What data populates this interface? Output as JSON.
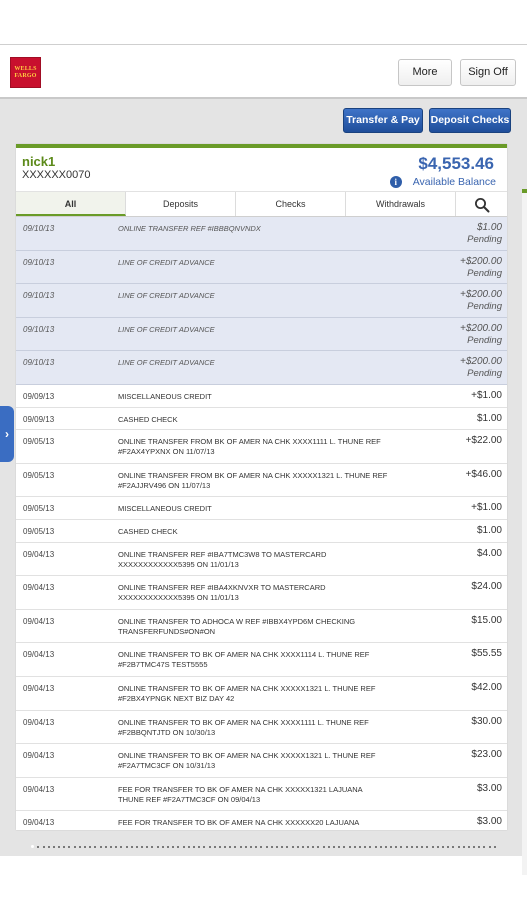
{
  "brand": {
    "logo_line1": "WELLS",
    "logo_line2": "FARGO"
  },
  "header": {
    "more_label": "More",
    "signoff_label": "Sign Off"
  },
  "actions": {
    "transfer_label": "Transfer & Pay",
    "deposit_label": "Deposit Checks"
  },
  "account": {
    "name": "nick1",
    "number": "XXXXXX0070",
    "balance": "$4,553.46",
    "balance_label": "Available Balance"
  },
  "tabs": [
    {
      "label": "All",
      "active": true
    },
    {
      "label": "Deposits",
      "active": false
    },
    {
      "label": "Checks",
      "active": false
    },
    {
      "label": "Withdrawals",
      "active": false
    }
  ],
  "transactions": [
    {
      "date": "09/10/13",
      "desc": "ONLINE TRANSFER REF #IBBBQNVNDX",
      "amount": "$1.00",
      "status": "Pending",
      "pending": true
    },
    {
      "date": "09/10/13",
      "desc": "LINE OF CREDIT ADVANCE",
      "amount": "+$200.00",
      "status": "Pending",
      "pending": true
    },
    {
      "date": "09/10/13",
      "desc": "LINE OF CREDIT ADVANCE",
      "amount": "+$200.00",
      "status": "Pending",
      "pending": true
    },
    {
      "date": "09/10/13",
      "desc": "LINE OF CREDIT ADVANCE",
      "amount": "+$200.00",
      "status": "Pending",
      "pending": true
    },
    {
      "date": "09/10/13",
      "desc": "LINE OF CREDIT ADVANCE",
      "amount": "+$200.00",
      "status": "Pending",
      "pending": true
    },
    {
      "date": "09/09/13",
      "desc": "MISCELLANEOUS CREDIT",
      "amount": "+$1.00",
      "status": "",
      "pending": false
    },
    {
      "date": "09/09/13",
      "desc": "CASHED CHECK",
      "amount": "$1.00",
      "status": "",
      "pending": false
    },
    {
      "date": "09/05/13",
      "desc": "ONLINE TRANSFER FROM BK OF AMER NA CHK XXXX1111 L. THUNE REF #F2AX4YPXNX ON 11/07/13",
      "amount": "+$22.00",
      "status": "",
      "pending": false
    },
    {
      "date": "09/05/13",
      "desc": "ONLINE TRANSFER FROM BK OF AMER NA CHK XXXXX1321 L. THUNE REF #F2AJJRV496 ON 11/07/13",
      "amount": "+$46.00",
      "status": "",
      "pending": false
    },
    {
      "date": "09/05/13",
      "desc": "MISCELLANEOUS CREDIT",
      "amount": "+$1.00",
      "status": "",
      "pending": false
    },
    {
      "date": "09/05/13",
      "desc": "CASHED CHECK",
      "amount": "$1.00",
      "status": "",
      "pending": false
    },
    {
      "date": "09/04/13",
      "desc": "ONLINE TRANSFER REF #IBA7TMC3W8 TO MASTERCARD XXXXXXXXXXXX5395 ON 11/01/13",
      "amount": "$4.00",
      "status": "",
      "pending": false
    },
    {
      "date": "09/04/13",
      "desc": "ONLINE TRANSFER REF #IBA4XKNVXR TO MASTERCARD XXXXXXXXXXXX5395 ON 11/01/13",
      "amount": "$24.00",
      "status": "",
      "pending": false
    },
    {
      "date": "09/04/13",
      "desc": "ONLINE TRANSFER TO ADHOCA W REF #IBBX4YPD6M CHECKING TRANSFERFUNDS#ON#ON",
      "amount": "$15.00",
      "status": "",
      "pending": false
    },
    {
      "date": "09/04/13",
      "desc": "ONLINE TRANSFER TO BK OF AMER NA CHK XXXX1114 L. THUNE REF #F2B7TMC47S TEST5555",
      "amount": "$55.55",
      "status": "",
      "pending": false
    },
    {
      "date": "09/04/13",
      "desc": "ONLINE TRANSFER TO BK OF AMER NA CHK XXXXX1321 L. THUNE REF #F2BX4YPNGK NEXT BIZ DAY 42",
      "amount": "$42.00",
      "status": "",
      "pending": false
    },
    {
      "date": "09/04/13",
      "desc": "ONLINE TRANSFER TO BK OF AMER NA CHK XXXX1111 L. THUNE REF #F2BBQNTJTD ON 10/30/13",
      "amount": "$30.00",
      "status": "",
      "pending": false
    },
    {
      "date": "09/04/13",
      "desc": "ONLINE TRANSFER TO BK OF AMER NA CHK XXXXX1321 L. THUNE REF #F2A7TMC3CF ON 10/31/13",
      "amount": "$23.00",
      "status": "",
      "pending": false
    },
    {
      "date": "09/04/13",
      "desc": "FEE FOR TRANSFER TO BK OF AMER NA CHK XXXXX1321 LAJUANA THUNE REF #F2A7TMC3CF ON 09/04/13",
      "amount": "$3.00",
      "status": "",
      "pending": false
    },
    {
      "date": "09/04/13",
      "desc": "FEE FOR TRANSFER TO BK OF AMER NA CHK XXXXXX20 LAJUANA",
      "amount": "$3.00",
      "status": "",
      "pending": false
    }
  ],
  "pager": {
    "count": 90,
    "active_index": 0
  }
}
